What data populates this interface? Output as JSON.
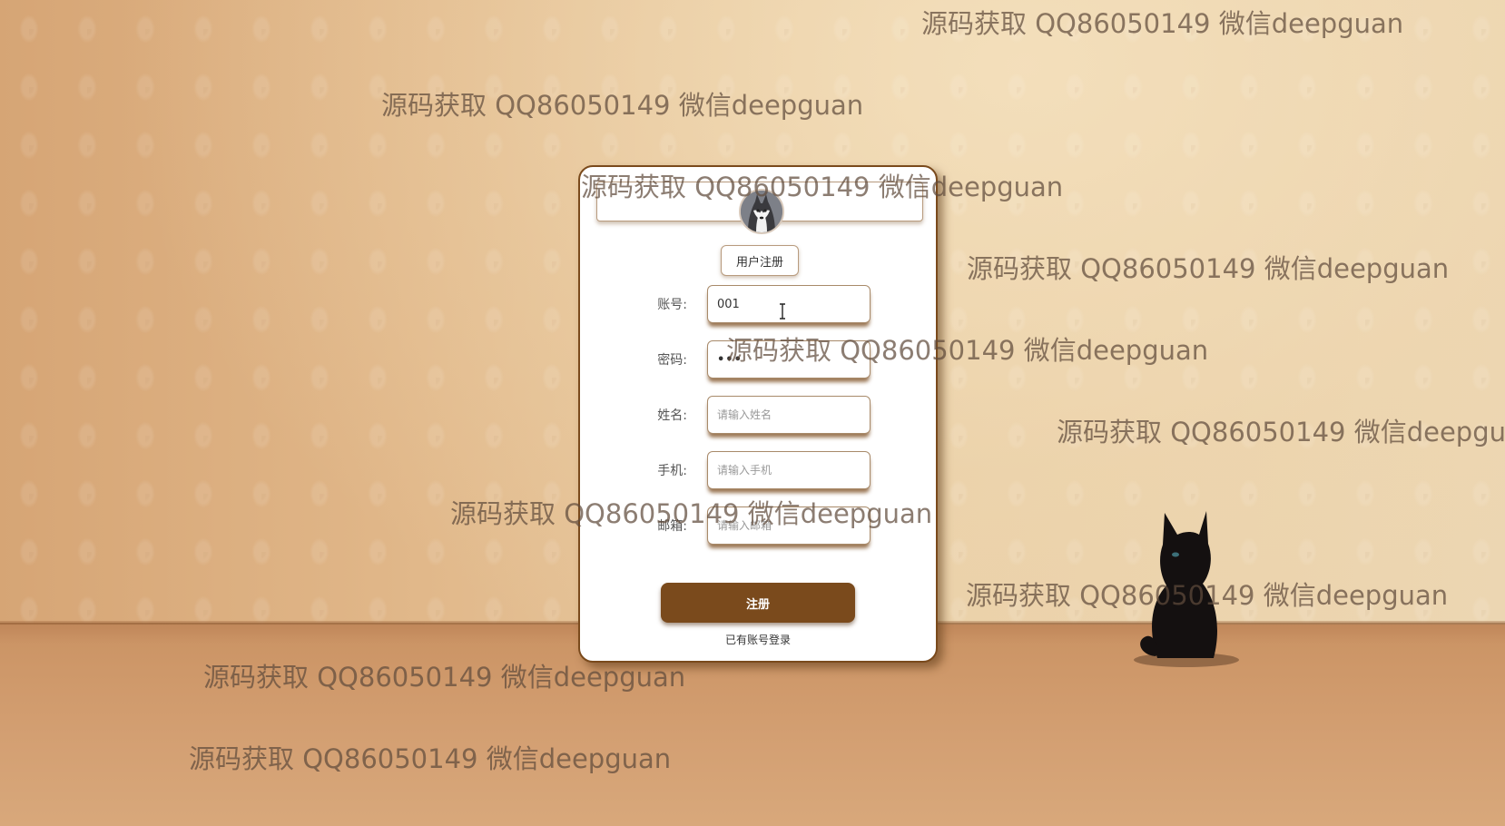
{
  "form": {
    "title_button": "用户注册",
    "fields": [
      {
        "label": "账号:",
        "value": "001",
        "placeholder": ""
      },
      {
        "label": "密码:",
        "value": "•••",
        "placeholder": ""
      },
      {
        "label": "姓名:",
        "value": "",
        "placeholder": "请输入姓名"
      },
      {
        "label": "手机:",
        "value": "",
        "placeholder": "请输入手机"
      },
      {
        "label": "邮箱:",
        "value": "",
        "placeholder": "请输入邮箱"
      }
    ],
    "submit_label": "注册",
    "login_link": "已有账号登录"
  },
  "watermark": "源码获取 QQ86050149 微信deepguan",
  "colors": {
    "accent": "#7a4a1c",
    "card_bg": "#ffffff"
  },
  "icons": {
    "avatar": "husky-dog-avatar-icon",
    "cat": "black-cat-decoration"
  }
}
